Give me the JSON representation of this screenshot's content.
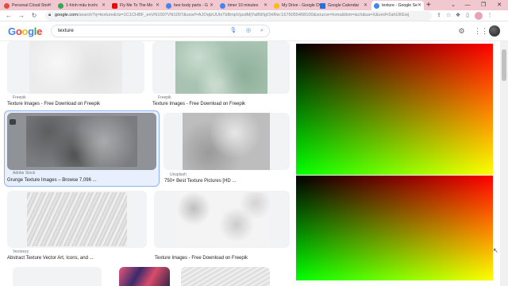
{
  "browser": {
    "tabs": [
      {
        "title": "Personal Cloud Stor",
        "favicon_color": "#e24a3b"
      },
      {
        "title": "1-hình mẫu trước",
        "favicon_color": "#34a853"
      },
      {
        "title": "Fly Me To The Mo",
        "favicon_color": "#ff0000"
      },
      {
        "title": "bee body parts - G",
        "favicon_color": "#4285f4"
      },
      {
        "title": "timer 10 minutes",
        "favicon_color": "#4285f4"
      },
      {
        "title": "My Drive - Google D",
        "favicon_color": "#fbbc05"
      },
      {
        "title": "Google Calendar",
        "favicon_color": "#1a73e8"
      },
      {
        "title": "texture - Google Se",
        "favicon_color": "#4285f4"
      }
    ],
    "active_tab_index": 7,
    "new_tab_label": "+",
    "window_controls": {
      "tabsearch": "⌄",
      "minimize": "—",
      "restore": "❐",
      "close": "✕"
    },
    "nav": {
      "back": "←",
      "forward": "→",
      "reload": "↻"
    },
    "url_host": "google.com",
    "url_path": "/search?q=texture&rlz=1C1CHBF_enVN1007VN1007&sxsrf=AJOqlzUUtxTkBmpVpzdMjYa8WIgOHRw:1676055468100&source=lnms&tbm=isch&sa=X&ved=2ahUKEwj"
  },
  "header": {
    "logo_letters": [
      {
        "ch": "G",
        "color": "#4285f4"
      },
      {
        "ch": "o",
        "color": "#ea4335"
      },
      {
        "ch": "o",
        "color": "#fbbc05"
      },
      {
        "ch": "g",
        "color": "#4285f4"
      },
      {
        "ch": "l",
        "color": "#34a853"
      },
      {
        "ch": "e",
        "color": "#ea4335"
      }
    ],
    "query": "texture",
    "icons": {
      "mic": "mic-icon",
      "lens": "lens-icon",
      "search": "search-icon",
      "settings": "gear-icon",
      "apps": "apps-grid-icon"
    }
  },
  "results": [
    {
      "source": "Freepik",
      "title": "Texture Images - Free Download on Freepik",
      "palette": "light-grey"
    },
    {
      "source": "Freepik",
      "title": "Texture Images - Free Download on Freepik",
      "palette": "green-marble"
    },
    {
      "source": "Adobe Stock",
      "title": "Grunge Texture Images – Browse 7,096 ...",
      "palette": "dark-grey"
    },
    {
      "source": "Unsplash",
      "title": "750+ Best Texture Pictures [HD ...",
      "palette": "mid-grey"
    },
    {
      "source": "Vecteezy",
      "title": "Abstract Texture Vector Art, Icons, and ...",
      "palette": "silver"
    },
    {
      "source": "Freepik",
      "title": "Texture Images - Free Download on Freepik",
      "palette": "white-grunge"
    }
  ],
  "colors": {
    "tabstrip": "#f1c7d0",
    "selection": "#e8f0fe",
    "selection_border": "#8ab4f8"
  }
}
